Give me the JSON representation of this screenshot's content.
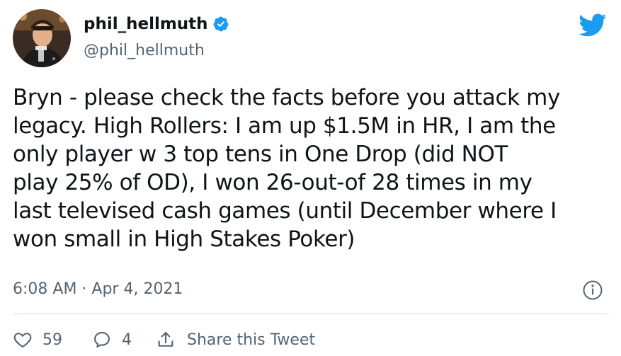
{
  "header": {
    "display_name": "phil_hellmuth",
    "handle": "@phil_hellmuth"
  },
  "tweet": {
    "lines": [
      "Bryn - please check the facts before you attack my",
      "legacy. High Rollers: I am up $1.5M in HR, I am the",
      "only player w 3 top tens in One Drop (did NOT",
      "play 25% of OD), I won 26-out-of 28 times in my",
      "last televised cash games (until December where I",
      "won small in High Stakes Poker)"
    ],
    "timestamp": "6:08 AM · Apr 4, 2021"
  },
  "actions": {
    "like_count": "59",
    "reply_count": "4",
    "share_label": "Share this Tweet"
  },
  "icons": {
    "verified": "verified-badge-icon",
    "brand": "twitter-bird-icon",
    "info": "info-icon",
    "like": "heart-icon",
    "reply": "speech-bubble-icon",
    "share": "share-upload-icon"
  },
  "colors": {
    "brand_blue": "#1d9bf0",
    "text_primary": "#0f1419",
    "text_secondary": "#536471",
    "divider": "#cfd9de"
  }
}
